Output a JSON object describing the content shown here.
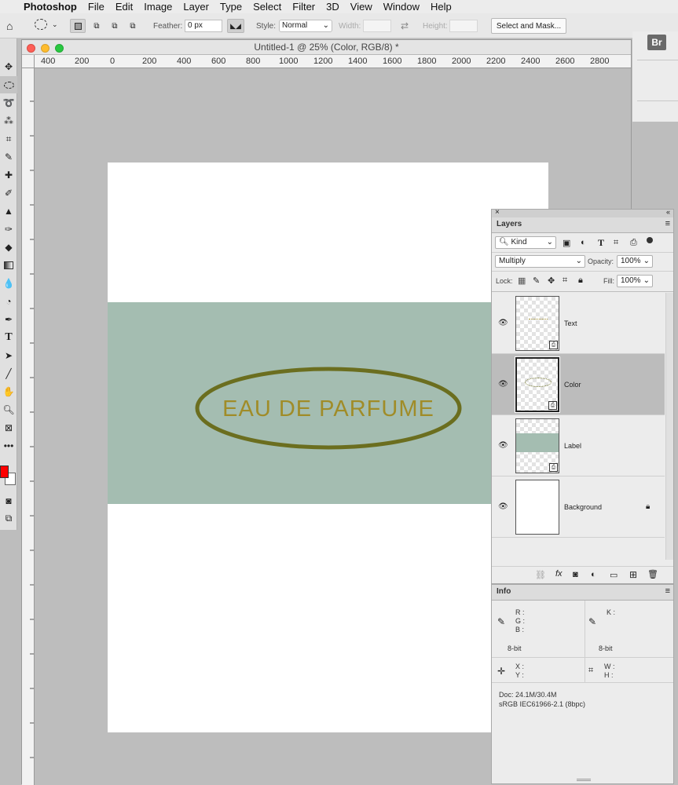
{
  "menubar": {
    "app_name": "Photoshop",
    "items": [
      "File",
      "Edit",
      "Image",
      "Layer",
      "Type",
      "Select",
      "Filter",
      "3D",
      "View",
      "Window",
      "Help"
    ]
  },
  "options_bar": {
    "feather_label": "Feather:",
    "feather_value": "0 px",
    "style_label": "Style:",
    "style_value": "Normal",
    "width_label": "Width:",
    "height_label": "Height:",
    "select_mask_label": "Select and Mask..."
  },
  "document": {
    "title": "Untitled-1 @ 25% (Color, RGB/8) *",
    "ruler_ticks": [
      "400",
      "200",
      "0",
      "200",
      "400",
      "600",
      "800",
      "1000",
      "1200",
      "1400",
      "1600",
      "1800",
      "2000",
      "2200",
      "2400",
      "2600",
      "2800"
    ],
    "label_text": "EAU DE PARFUME",
    "colors": {
      "band": "#a4bdb1",
      "ellipse": "#6b6e1f",
      "text": "#a08c28"
    }
  },
  "right_strip": {
    "br_label": "Br"
  },
  "layers_panel": {
    "tab": "Layers",
    "filter_kind": "Kind",
    "blend_mode": "Multiply",
    "opacity_label": "Opacity:",
    "opacity_value": "100%",
    "lock_label": "Lock:",
    "fill_label": "Fill:",
    "fill_value": "100%",
    "layers": [
      {
        "name": "Text",
        "selected": false
      },
      {
        "name": "Color",
        "selected": true
      },
      {
        "name": "Label",
        "selected": false
      },
      {
        "name": "Background",
        "selected": false
      }
    ]
  },
  "info_panel": {
    "tab": "Info",
    "r_label": "R :",
    "g_label": "G :",
    "b_label": "B :",
    "k_label": "K :",
    "bit_left": "8-bit",
    "bit_right": "8-bit",
    "x_label": "X :",
    "y_label": "Y :",
    "w_label": "W :",
    "h_label": "H :",
    "doc_size": "Doc: 24.1M/30.4M",
    "profile": "sRGB IEC61966-2.1 (8bpc)"
  },
  "colors": {
    "foreground": "#ff0000",
    "background": "#ffffff"
  }
}
